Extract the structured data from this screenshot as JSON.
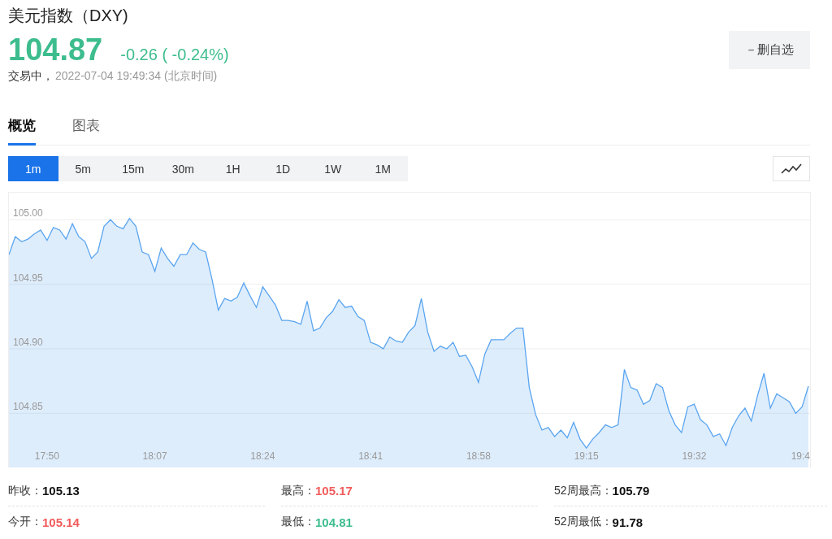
{
  "header": {
    "title": "美元指数（DXY)",
    "price": "104.87",
    "change": "-0.26",
    "change_pct": "( -0.24%)",
    "status": "交易中，",
    "time": "2022-07-04 19:49:34",
    "timezone": "(北京时间)",
    "watch_button": "－删自选"
  },
  "tabs": [
    {
      "label": "概览",
      "selected": true
    },
    {
      "label": "图表",
      "selected": false
    }
  ],
  "intervals": [
    {
      "label": "1m",
      "selected": true
    },
    {
      "label": "5m",
      "selected": false
    },
    {
      "label": "15m",
      "selected": false
    },
    {
      "label": "30m",
      "selected": false
    },
    {
      "label": "1H",
      "selected": false
    },
    {
      "label": "1D",
      "selected": false
    },
    {
      "label": "1W",
      "selected": false
    },
    {
      "label": "1M",
      "selected": false
    }
  ],
  "chart": {
    "chart_data": {
      "type": "area",
      "grid": true,
      "categories": [
        null,
        null,
        null,
        null,
        null,
        null,
        "17:50",
        null,
        null,
        null,
        null,
        null,
        null,
        null,
        null,
        null,
        null,
        null,
        null,
        null,
        null,
        null,
        null,
        "18:07",
        null,
        null,
        null,
        null,
        null,
        null,
        null,
        null,
        null,
        null,
        null,
        null,
        null,
        null,
        null,
        null,
        "18:24",
        null,
        null,
        null,
        null,
        null,
        null,
        null,
        null,
        null,
        null,
        null,
        null,
        null,
        null,
        null,
        null,
        "18:41",
        null,
        null,
        null,
        null,
        null,
        null,
        null,
        null,
        null,
        null,
        null,
        null,
        null,
        null,
        null,
        null,
        "18:58",
        null,
        null,
        null,
        null,
        null,
        null,
        null,
        null,
        null,
        null,
        null,
        null,
        null,
        null,
        null,
        null,
        "19:15",
        null,
        null,
        null,
        null,
        null,
        null,
        null,
        null,
        null,
        null,
        null,
        null,
        null,
        null,
        null,
        null,
        "19:32",
        null,
        null,
        null,
        null,
        null,
        null,
        null,
        null,
        null,
        null,
        null,
        null,
        null,
        null,
        null,
        null,
        "19:4",
        null
      ],
      "ylim": [
        104.808,
        105.021
      ],
      "yticks": [
        {
          "value": 104.85,
          "label": "104.85"
        },
        {
          "value": 104.9,
          "label": "104.90"
        },
        {
          "value": 104.95,
          "label": "104.95"
        },
        {
          "value": 105,
          "label": "105.00"
        }
      ],
      "series": [
        {
          "color": "#5aa5f0",
          "values": [
            104.973,
            104.987,
            104.983,
            104.985,
            104.989,
            104.992,
            104.984,
            104.994,
            104.992,
            104.985,
            104.997,
            104.987,
            104.983,
            104.97,
            104.975,
            104.995,
            105.0,
            104.995,
            104.993,
            105.001,
            104.995,
            104.975,
            104.973,
            104.96,
            104.978,
            104.97,
            104.964,
            104.973,
            104.973,
            104.982,
            104.977,
            104.975,
            104.954,
            104.93,
            104.939,
            104.937,
            104.94,
            104.951,
            104.941,
            104.932,
            104.948,
            104.941,
            104.934,
            104.922,
            104.922,
            104.921,
            104.919,
            104.937,
            104.914,
            104.916,
            104.924,
            104.929,
            104.938,
            104.932,
            104.933,
            104.925,
            104.922,
            104.905,
            104.903,
            104.9,
            104.909,
            104.906,
            104.905,
            104.913,
            104.918,
            104.939,
            104.913,
            104.898,
            104.902,
            104.9,
            104.905,
            104.894,
            104.895,
            104.886,
            104.874,
            104.896,
            104.907,
            104.907,
            104.907,
            104.912,
            104.916,
            104.916,
            104.87,
            104.849,
            104.837,
            104.839,
            104.832,
            104.837,
            104.831,
            104.843,
            104.83,
            104.823,
            104.83,
            104.835,
            104.841,
            104.839,
            104.841,
            104.884,
            104.87,
            104.868,
            104.857,
            104.86,
            104.873,
            104.87,
            104.852,
            104.841,
            104.835,
            104.855,
            104.857,
            104.845,
            104.841,
            104.832,
            104.834,
            104.825,
            104.839,
            104.848,
            104.854,
            104.844,
            104.864,
            104.881,
            104.854,
            104.865,
            104.862,
            104.859,
            104.85,
            104.855,
            104.871
          ]
        }
      ]
    }
  },
  "stats": [
    {
      "label": "昨收：",
      "value": "105.13",
      "color": "#111111"
    },
    {
      "label": "最高：",
      "value": "105.17",
      "color": "#f25b5b"
    },
    {
      "label": "52周最高：",
      "value": "105.79",
      "color": "#111111"
    },
    {
      "label": "今开：",
      "value": "105.14",
      "color": "#f25b5b"
    },
    {
      "label": "最低：",
      "value": "104.81",
      "color": "#3dbd8e"
    },
    {
      "label": "52周最低：",
      "value": "91.78",
      "color": "#111111"
    }
  ]
}
